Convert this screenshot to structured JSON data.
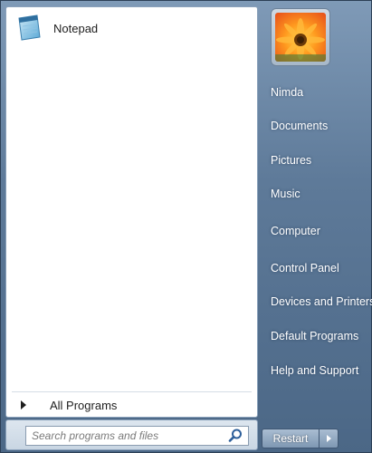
{
  "programs": [
    {
      "label": "Notepad",
      "icon": "notepad-icon"
    }
  ],
  "all_programs_label": "All Programs",
  "search": {
    "placeholder": "Search programs and files",
    "value": "",
    "icon": "magnifier-icon"
  },
  "user": {
    "avatar": "flower-picture"
  },
  "right_links": {
    "user_name": "Nimda",
    "documents": "Documents",
    "pictures": "Pictures",
    "music": "Music",
    "computer": "Computer",
    "control_panel": "Control Panel",
    "devices_printers": "Devices and Printers",
    "default_programs": "Default Programs",
    "help_support": "Help and Support"
  },
  "shutdown": {
    "label": "Restart",
    "options_icon": "arrow-right-icon"
  },
  "colors": {
    "pane_bg": "#ffffff",
    "right_pane": "#5e7a99",
    "accent": "#4b6786"
  }
}
